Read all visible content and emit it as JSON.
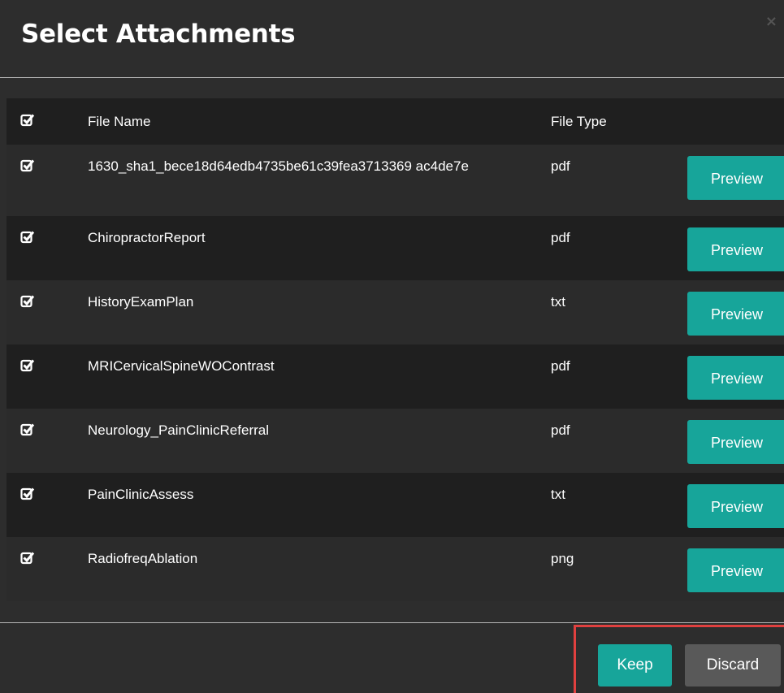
{
  "dialog": {
    "title": "Select Attachments",
    "close_glyph": "×"
  },
  "table": {
    "headers": {
      "name": "File Name",
      "type": "File Type"
    },
    "rows": [
      {
        "name": "1630_sha1_bece18d64edb4735be61c39fea3713369 ac4de7e",
        "type": "pdf",
        "checked": true,
        "preview_label": "Preview"
      },
      {
        "name": "ChiropractorReport",
        "type": "pdf",
        "checked": true,
        "preview_label": "Preview"
      },
      {
        "name": "HistoryExamPlan",
        "type": "txt",
        "checked": true,
        "preview_label": "Preview"
      },
      {
        "name": "MRICervicalSpineWOContrast",
        "type": "pdf",
        "checked": true,
        "preview_label": "Preview"
      },
      {
        "name": "Neurology_PainClinicReferral",
        "type": "pdf",
        "checked": true,
        "preview_label": "Preview"
      },
      {
        "name": "PainClinicAssess",
        "type": "txt",
        "checked": true,
        "preview_label": "Preview"
      },
      {
        "name": "RadiofreqAblation",
        "type": "png",
        "checked": true,
        "preview_label": "Preview"
      }
    ]
  },
  "footer": {
    "keep_label": "Keep",
    "discard_label": "Discard"
  },
  "colors": {
    "accent": "#17a59a",
    "secondary_button": "#595959",
    "highlight": "#e0403f"
  }
}
